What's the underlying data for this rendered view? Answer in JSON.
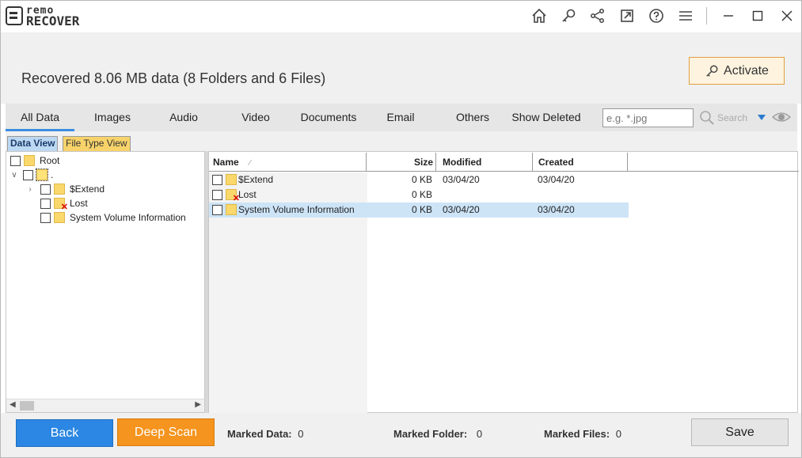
{
  "app": {
    "logo_top": "remo",
    "logo_bottom": "RECOVER"
  },
  "titlebar": {
    "icons": [
      "home-icon",
      "key-icon",
      "share-icon",
      "external-link-icon",
      "help-icon",
      "menu-icon"
    ],
    "window_controls": [
      "minimize-icon",
      "maximize-icon",
      "close-icon"
    ]
  },
  "header": {
    "status": "Recovered 8.06 MB data (8 Folders and 6 Files)",
    "activate_label": "Activate"
  },
  "tabs": [
    "All Data",
    "Images",
    "Audio",
    "Video",
    "Documents",
    "Email",
    "Others",
    "Show Deleted"
  ],
  "active_tab": "All Data",
  "search": {
    "placeholder": "e.g. *.jpg",
    "button_label": "Search"
  },
  "view_tabs": {
    "data_view": "Data View",
    "file_type_view": "File Type View"
  },
  "tree": {
    "root": "Root",
    "drive": ".",
    "children": [
      "$Extend",
      "Lost",
      "System Volume Information"
    ]
  },
  "list": {
    "columns": {
      "name": "Name",
      "size": "Size",
      "modified": "Modified",
      "created": "Created"
    },
    "rows": [
      {
        "name": "$Extend",
        "size": "0 KB",
        "modified": "03/04/20",
        "created": "03/04/20"
      },
      {
        "name": "Lost",
        "size": "0 KB",
        "modified": "",
        "created": ""
      },
      {
        "name": "System Volume Information",
        "size": "0 KB",
        "modified": "03/04/20",
        "created": "03/04/20"
      }
    ]
  },
  "footer": {
    "back_label": "Back",
    "deep_scan_label": "Deep Scan",
    "marked_data_label": "Marked Data:",
    "marked_data_value": "0",
    "marked_folder_label": "Marked Folder:",
    "marked_folder_value": "0",
    "marked_files_label": "Marked Files:",
    "marked_files_value": "0",
    "save_label": "Save"
  },
  "colors": {
    "accent_blue": "#2b87e3",
    "accent_orange": "#f5941e",
    "selection": "#cde4f7"
  }
}
